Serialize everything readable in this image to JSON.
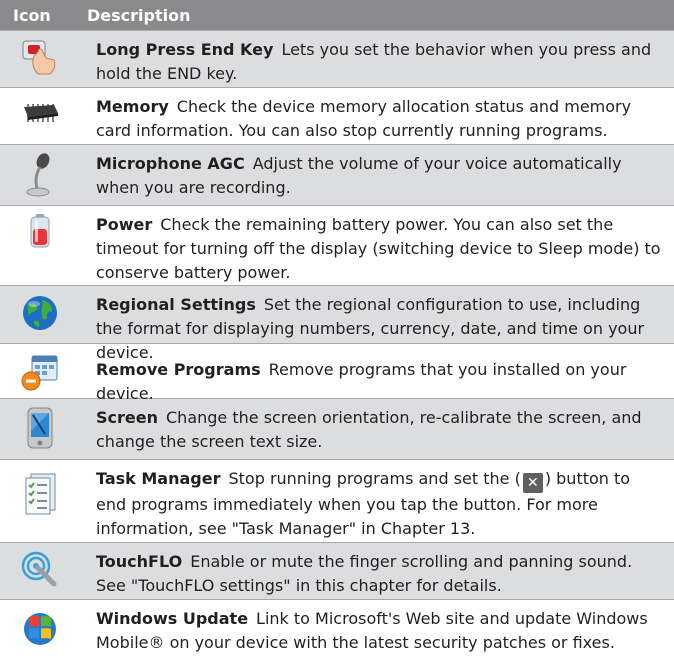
{
  "header": {
    "col_icon": "Icon",
    "col_desc": "Description"
  },
  "rows": [
    {
      "icon": "long-press-end-key-icon",
      "title": "Long Press End Key",
      "text": "Lets you set the behavior when you press and hold the END key."
    },
    {
      "icon": "memory-icon",
      "title": "Memory",
      "text": "Check the device memory allocation status and memory card information. You can also stop currently running programs."
    },
    {
      "icon": "microphone-icon",
      "title": "Microphone AGC",
      "text": "Adjust the volume of your voice automatically when you are recording."
    },
    {
      "icon": "battery-icon",
      "title": "Power",
      "text": "Check the remaining battery power. You can also set the timeout for turning off the display (switching device to Sleep mode) to conserve battery power."
    },
    {
      "icon": "globe-icon",
      "title": "Regional Settings",
      "text": "Set the regional configuration to use, including the format for displaying numbers, currency, date, and time on your device."
    },
    {
      "icon": "remove-programs-icon",
      "title": "Remove Programs",
      "text": "Remove programs that you installed on your device."
    },
    {
      "icon": "screen-icon",
      "title": "Screen",
      "text": "Change the screen orientation, re-calibrate the screen, and change the screen text size."
    },
    {
      "icon": "task-manager-icon",
      "title": "Task Manager",
      "text_before": "Stop running programs and set the (",
      "text_after": ") button to end programs immediately when you tap the button. For more information, see \"Task Manager\" in Chapter 13.",
      "button_glyph": "✕"
    },
    {
      "icon": "touchflo-icon",
      "title": "TouchFLO",
      "text": "Enable or mute the finger scrolling and panning sound. See \"TouchFLO settings\" in this chapter for details."
    },
    {
      "icon": "windows-update-icon",
      "title": "Windows Update",
      "text": "Link to Microsoft's Web site and update Windows Mobile® on your device with the latest security patches or fixes."
    }
  ]
}
